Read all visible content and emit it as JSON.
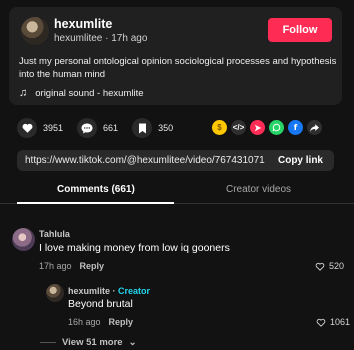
{
  "post": {
    "author_name": "hexumlite",
    "author_handle": "hexumlitee",
    "time_ago": "17h ago",
    "follow_label": "Follow",
    "caption": "Just my personal ontological opinion sociological processes and hypothesis into the human mind",
    "music_icon": "music-note-icon",
    "music": "original sound - hexumlite"
  },
  "actions": {
    "likes": "3951",
    "comments": "661",
    "saves": "350"
  },
  "share_icons": [
    "coin-icon",
    "embed-icon",
    "send-icon",
    "whatsapp-icon",
    "facebook-icon",
    "share-arrow-icon"
  ],
  "share_colors": {
    "coin": "#fec700",
    "embed": "#2f2f2f",
    "send": "#fe2c55",
    "whatsapp": "#25d366",
    "facebook": "#1877f2",
    "share": "#2f2f2f"
  },
  "link": {
    "url": "https://www.tiktok.com/@hexumlitee/video/767431071...",
    "copy_label": "Copy link"
  },
  "tabs": {
    "comments": "Comments (661)",
    "creator_videos": "Creator videos"
  },
  "comments": [
    {
      "user": "Tahlula",
      "text": "I love making money from low iq gooners",
      "time": "17h ago",
      "reply_label": "Reply",
      "likes": "520",
      "replies": [
        {
          "user": "hexumlite",
          "separator": "·",
          "creator_tag": "Creator",
          "text": "Beyond brutal",
          "time": "16h ago",
          "reply_label": "Reply",
          "likes": "1061"
        }
      ],
      "view_more": "View 51 more"
    }
  ],
  "colors": {
    "accent": "#fe2c55",
    "creator": "#20d5ec",
    "background": "#121212"
  }
}
